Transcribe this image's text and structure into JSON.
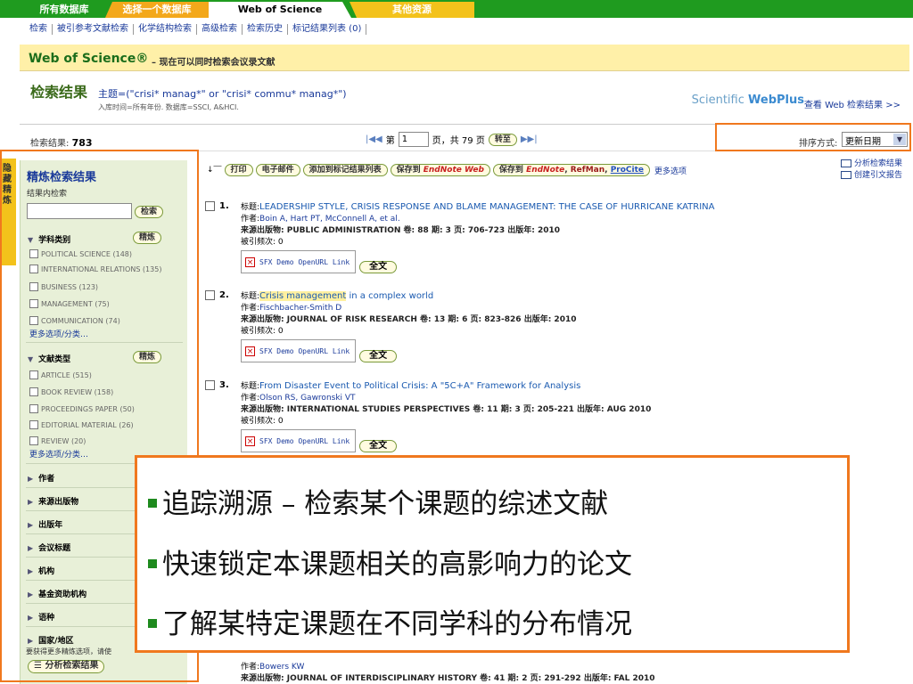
{
  "topbar": {
    "tabs": [
      "所有数据库",
      "选择一个数据库",
      "Web of Science",
      "其他资源"
    ]
  },
  "subnav": [
    "检索",
    "被引参考文献检索",
    "化学结构检索",
    "高级检索",
    "检索历史",
    "标记结果列表 (0)"
  ],
  "band": {
    "title": "Web of Science®",
    "subtitle": "– 现在可以同时检索会议录文献"
  },
  "results": {
    "heading": "检索结果",
    "topic": "主题=(\"crisi* manag*\" or \"crisi* commu* manag*\")",
    "meta": "入库时间=所有年份. 数据库=SSCI, A&HCI.",
    "webplus_pre": "Scientific ",
    "webplus_brand": "WebPlus",
    "webplus_link": "查看 Web 检索结果 >>"
  },
  "pager": {
    "count_label": "检索结果:",
    "count": "783",
    "first_prev": "|◀◀",
    "page_prefix": "第",
    "page_value": "1",
    "page_suffix": "页，共 79 页",
    "go": "转至",
    "next_last": "▶▶|",
    "sort_label": "排序方式:",
    "sort_value": "更新日期"
  },
  "sidebar": {
    "hide_tab": "隐藏精炼",
    "title": "精炼检索结果",
    "within_label": "结果内检索",
    "search_btn": "检索",
    "subject": {
      "label": "学科类别",
      "btn": "精炼"
    },
    "subject_items": [
      "POLITICAL SCIENCE (148)",
      "INTERNATIONAL RELATIONS (135)",
      "BUSINESS (123)",
      "MANAGEMENT (75)",
      "COMMUNICATION (74)"
    ],
    "more1": "更多选项/分类…",
    "doctype": {
      "label": "文献类型",
      "btn": "精炼"
    },
    "doctype_items": [
      "ARTICLE (515)",
      "BOOK REVIEW (158)",
      "PROCEEDINGS PAPER (50)",
      "EDITORIAL MATERIAL (26)",
      "REVIEW (20)"
    ],
    "more2": "更多选项/分类…",
    "collapsed": [
      "作者",
      "来源出版物",
      "出版年",
      "会议标题",
      "机构",
      "基金资助机构",
      "语种",
      "国家/地区"
    ],
    "hint": "要获得更多精炼选项，请使",
    "analyze_btn": "分析检索结果"
  },
  "toolbar": {
    "print": "打印",
    "email": "电子邮件",
    "add_marked": "添加到标记结果列表",
    "save_to": "保存到",
    "endnote_web": "EndNote Web",
    "save_to2": "保存到",
    "endnote": "EndNote",
    "refman": "RefMan",
    "procite": "ProCite",
    "more": "更多选项",
    "analyze": "分析检索结果",
    "citation_report": "创建引文报告"
  },
  "records": [
    {
      "num": "1.",
      "title_label": "标题:",
      "title": "LEADERSHIP STYLE, CRISIS RESPONSE AND BLAME MANAGEMENT: THE CASE OF HURRICANE KATRINA",
      "authors_label": "作者:",
      "authors": "Boin A, Hart PT, McConnell A, et al.",
      "source": "来源出版物: PUBLIC ADMINISTRATION  卷: 88  期: 3  页: 706-723  出版年: 2010",
      "cited": "被引频次: 0"
    },
    {
      "num": "2.",
      "title_label": "标题:",
      "title_hl": "Crisis management",
      "title": " in a complex world",
      "authors_label": "作者:",
      "authors": "Fischbacher-Smith D",
      "source": "来源出版物: JOURNAL OF RISK RESEARCH  卷: 13  期: 6  页: 823-826  出版年: 2010",
      "cited": "被引频次: 0"
    },
    {
      "num": "3.",
      "title_label": "标题:",
      "title": "From Disaster Event to Political Crisis: A \"5C+A\" Framework for Analysis",
      "authors_label": "作者:",
      "authors": "Olson RS, Gawronski VT",
      "source": "来源出版物: INTERNATIONAL STUDIES PERSPECTIVES  卷: 11  期: 3  页: 205-221  出版年: AUG 2010",
      "cited": "被引频次: 0"
    },
    {
      "authors_label": "作者:",
      "authors": "Bowers KW",
      "source": "来源出版物: JOURNAL OF INTERDISCIPLINARY HISTORY  卷: 41  期: 2  页: 291-292  出版年: FAL 2010"
    }
  ],
  "sfx_label": "SFX Demo OpenURL Link",
  "fulltext": "全文",
  "callout": [
    "追踪溯源 – 检索某个课题的综述文献",
    "快速锁定本课题相关的高影响力的论文",
    "了解某特定课题在不同学科的分布情况"
  ],
  "colors": {
    "green": "#1f9b1f",
    "orange": "#f0781e",
    "yellow": "#f3c21b"
  }
}
